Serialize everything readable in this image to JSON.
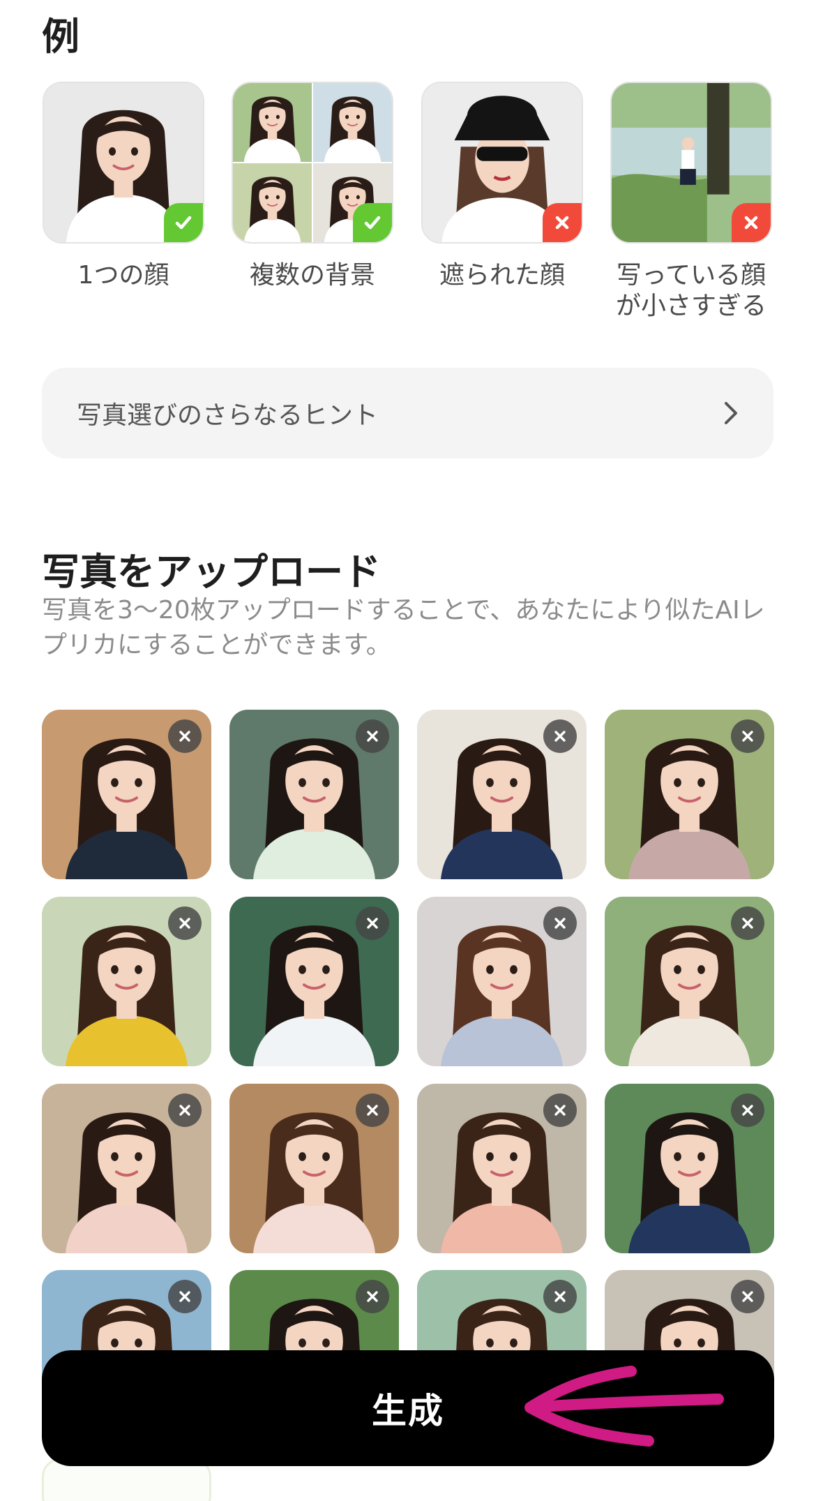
{
  "examples": {
    "heading": "例",
    "items": [
      {
        "caption": "1つの顔",
        "verdict": "ok",
        "bg": "#e9e9e9",
        "shirt": "#ffffff",
        "hair": "#2a1d18",
        "type": "single"
      },
      {
        "caption": "複数の背景",
        "verdict": "ok",
        "bg": "#cfe0c8",
        "shirt": "#ffffff",
        "hair": "#2a1d18",
        "type": "multi"
      },
      {
        "caption": "遮られた顔",
        "verdict": "ng",
        "bg": "#ececec",
        "shirt": "#ffffff",
        "hair": "#5a3a2a",
        "type": "hat"
      },
      {
        "caption": "写っている顔が小さすぎる",
        "verdict": "ng",
        "bg": "#9dbf8a",
        "shirt": "#ffffff",
        "hair": "#2a1d18",
        "type": "far"
      }
    ]
  },
  "hint": {
    "label": "写真選びのさらなるヒント"
  },
  "upload": {
    "title": "写真をアップロード",
    "description": "写真を3〜20枚アップロードすることで、あなたにより似たAIレプリカにすることができます。"
  },
  "photos": [
    {
      "bg": "#c79a70",
      "top": "#1f2a3a",
      "hair": "#2a1a14"
    },
    {
      "bg": "#5f7a6a",
      "top": "#dfeede",
      "hair": "#1e1612"
    },
    {
      "bg": "#e8e4dc",
      "top": "#24355c",
      "hair": "#2a1a14"
    },
    {
      "bg": "#9fb27a",
      "top": "#c6a9a6",
      "hair": "#2a1a14"
    },
    {
      "bg": "#c9d7b8",
      "top": "#e8c22e",
      "hair": "#3a2418"
    },
    {
      "bg": "#3f6a52",
      "top": "#f1f4f6",
      "hair": "#1e1612"
    },
    {
      "bg": "#d9d4d4",
      "top": "#b8c3d8",
      "hair": "#5a3422"
    },
    {
      "bg": "#8fb07a",
      "top": "#efe8df",
      "hair": "#3a2418"
    },
    {
      "bg": "#c7b39a",
      "top": "#f2d2c8",
      "hair": "#2a1a14"
    },
    {
      "bg": "#b48a62",
      "top": "#f4ddd6",
      "hair": "#4a2c1c"
    },
    {
      "bg": "#bfb7a8",
      "top": "#f0b8a6",
      "hair": "#3a2418"
    },
    {
      "bg": "#5e8a5a",
      "top": "#22365e",
      "hair": "#1e1612"
    },
    {
      "bg": "#8fb6d0",
      "top": "#ffffff",
      "hair": "#3a2418"
    },
    {
      "bg": "#5c8a4a",
      "top": "#ffffff",
      "hair": "#1e1612"
    },
    {
      "bg": "#9cc0a8",
      "top": "#ffffff",
      "hair": "#3a2418"
    },
    {
      "bg": "#c8c2b6",
      "top": "#ffffff",
      "hair": "#2a1a14"
    }
  ],
  "actions": {
    "generate_label": "生成"
  },
  "colors": {
    "ok": "#64c832",
    "ng": "#f24a3a",
    "annotation_arrow": "#d01a84"
  }
}
